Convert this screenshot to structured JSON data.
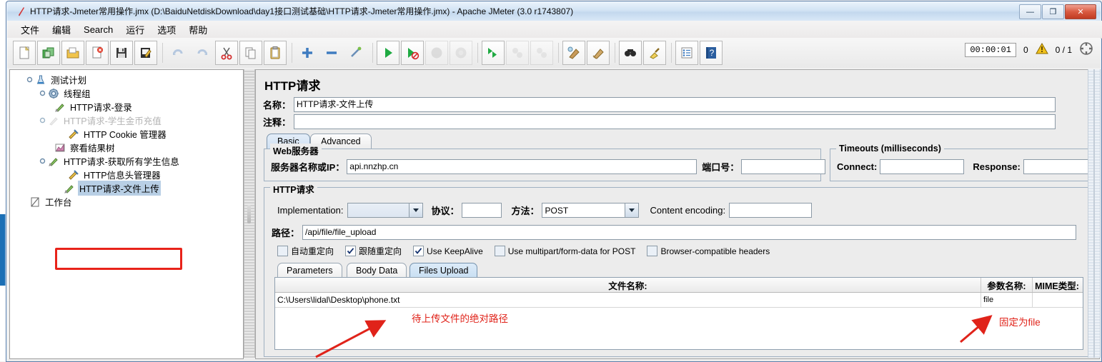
{
  "window": {
    "title": "HTTP请求-Jmeter常用操作.jmx (D:\\BaiduNetdiskDownload\\day1接口测试基础\\HTTP请求-Jmeter常用操作.jmx) - Apache JMeter (3.0 r1743807)",
    "minimize_label": "—",
    "maximize_label": "❐",
    "close_label": "✕",
    "app_icon": "jmeter-feather-icon"
  },
  "menu": {
    "items": [
      {
        "label": "文件"
      },
      {
        "label": "编辑"
      },
      {
        "label": "Search"
      },
      {
        "label": "运行"
      },
      {
        "label": "选项"
      },
      {
        "label": "帮助"
      }
    ]
  },
  "toolbar": {
    "buttons": [
      {
        "name": "new-icon",
        "enabled": true
      },
      {
        "name": "templates-icon",
        "enabled": true
      },
      {
        "name": "open-icon",
        "enabled": true
      },
      {
        "name": "close-icon",
        "enabled": true
      },
      {
        "name": "save-icon",
        "enabled": true
      },
      {
        "name": "save-as-icon",
        "enabled": true
      },
      {
        "name": "undo-icon",
        "enabled": false
      },
      {
        "name": "redo-icon",
        "enabled": false
      },
      {
        "name": "cut-icon",
        "enabled": true
      },
      {
        "name": "copy-icon",
        "enabled": true
      },
      {
        "name": "paste-icon",
        "enabled": true
      },
      {
        "name": "expand-all-icon",
        "enabled": true
      },
      {
        "name": "collapse-all-icon",
        "enabled": true
      },
      {
        "name": "toggle-icon",
        "enabled": true
      },
      {
        "name": "start-icon",
        "enabled": true
      },
      {
        "name": "start-no-pause-icon",
        "enabled": true
      },
      {
        "name": "stop-icon",
        "enabled": false
      },
      {
        "name": "shutdown-icon",
        "enabled": false
      },
      {
        "name": "start-remote-all-icon",
        "enabled": true
      },
      {
        "name": "stop-remote-all-icon",
        "enabled": false
      },
      {
        "name": "shutdown-remote-all-icon",
        "enabled": false
      },
      {
        "name": "clear-icon",
        "enabled": true
      },
      {
        "name": "clear-all-icon",
        "enabled": true
      },
      {
        "name": "search-icon",
        "enabled": true
      },
      {
        "name": "search-reset-icon",
        "enabled": true
      },
      {
        "name": "function-helper-icon",
        "enabled": true
      },
      {
        "name": "help-icon",
        "enabled": true
      }
    ],
    "timer": "00:00:01",
    "error_count": "0",
    "warning_icon": "warning-triangle-icon",
    "thread_ratio": "0 / 1",
    "remote_icon": "threads-indicator-icon"
  },
  "tree": {
    "nodes": [
      {
        "label": "测试计划",
        "icon": "test-plan-icon",
        "depth": 0,
        "state": "normal",
        "handle": "expanded"
      },
      {
        "label": "线程组",
        "icon": "thread-group-icon",
        "depth": 1,
        "state": "normal",
        "handle": "expanded"
      },
      {
        "label": "HTTP请求-登录",
        "icon": "http-sampler-icon",
        "depth": 2,
        "state": "normal",
        "handle": "none"
      },
      {
        "label": "HTTP请求-学生金币充值",
        "icon": "http-sampler-icon",
        "depth": 2,
        "state": "disabled",
        "handle": "expanded"
      },
      {
        "label": "HTTP Cookie 管理器",
        "icon": "cookie-manager-icon",
        "depth": 3,
        "state": "normal",
        "handle": "none"
      },
      {
        "label": "察看结果树",
        "icon": "view-results-icon",
        "depth": 2,
        "state": "normal",
        "handle": "none"
      },
      {
        "label": "HTTP请求-获取所有学生信息",
        "icon": "http-sampler-icon",
        "depth": 2,
        "state": "normal",
        "handle": "expanded"
      },
      {
        "label": "HTTP信息头管理器",
        "icon": "header-manager-icon",
        "depth": 3,
        "state": "normal",
        "handle": "none"
      },
      {
        "label": "HTTP请求-文件上传",
        "icon": "http-sampler-icon",
        "depth": 2,
        "state": "selected",
        "handle": "none"
      },
      {
        "label": "工作台",
        "icon": "workbench-icon",
        "depth": 0,
        "state": "normal",
        "handle": "none"
      }
    ]
  },
  "panel": {
    "title": "HTTP请求",
    "name_label": "名称：",
    "name_value": "HTTP请求-文件上传",
    "comment_label": "注释：",
    "comment_value": "",
    "tabs": [
      {
        "label": "Basic",
        "active": true
      },
      {
        "label": "Advanced",
        "active": false
      }
    ],
    "web_server": {
      "legend": "Web服务器",
      "server_label": "服务器名称或IP：",
      "server_value": "api.nnzhp.cn",
      "port_label": "端口号：",
      "port_value": ""
    },
    "timeouts": {
      "legend": "Timeouts (milliseconds)",
      "connect_label": "Connect:",
      "connect_value": "",
      "response_label": "Response:",
      "response_value": ""
    },
    "http_request": {
      "legend": "HTTP请求",
      "implementation_label": "Implementation:",
      "implementation_value": "",
      "protocol_label": "协议：",
      "protocol_value": "",
      "method_label": "方法：",
      "method_value": "POST",
      "content_encoding_label": "Content encoding:",
      "content_encoding_value": "",
      "path_label": "路径：",
      "path_value": "/api/file/file_upload",
      "checkboxes": [
        {
          "label": "自动重定向",
          "checked": false
        },
        {
          "label": "跟随重定向",
          "checked": true
        },
        {
          "label": "Use KeepAlive",
          "checked": true
        },
        {
          "label": "Use multipart/form-data for POST",
          "checked": false
        },
        {
          "label": "Browser-compatible headers",
          "checked": false
        }
      ],
      "inner_tabs": [
        {
          "label": "Parameters",
          "active": false
        },
        {
          "label": "Body Data",
          "active": false
        },
        {
          "label": "Files Upload",
          "active": true
        }
      ],
      "files_table": {
        "columns": [
          "文件名称:",
          "参数名称:",
          "MIME类型:"
        ],
        "rows": [
          {
            "file_name": "C:\\Users\\lidal\\Desktop\\phone.txt",
            "param_name": "file",
            "mime_type": ""
          }
        ]
      }
    }
  },
  "annotations": [
    {
      "text": "待上传文件的绝对路径",
      "color": "#e0231a"
    },
    {
      "text": "固定为file",
      "color": "#e0231a"
    }
  ],
  "colors": {
    "annotation_red": "#e0231a",
    "highlight_box": "#e8231a",
    "selection_blue": "#b8cfe5",
    "active_tab_blue": "#c9dff3"
  }
}
